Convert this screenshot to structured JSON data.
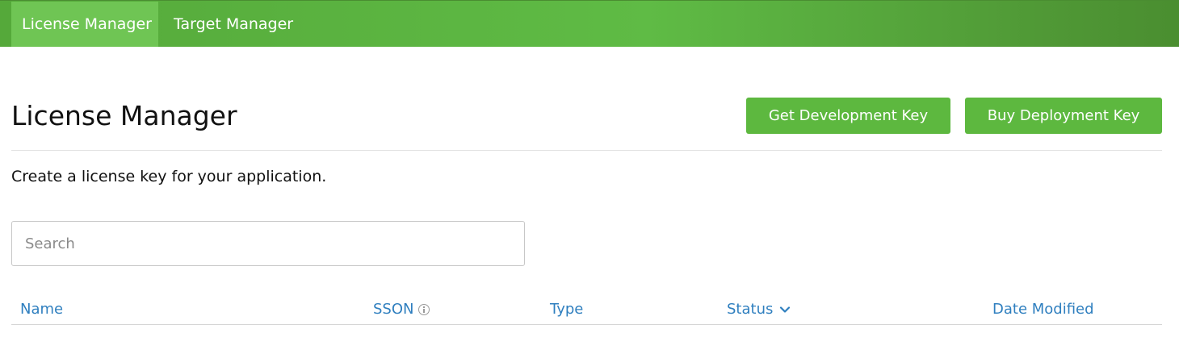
{
  "nav": {
    "tabs": [
      {
        "label": "License Manager",
        "active": true
      },
      {
        "label": "Target Manager",
        "active": false
      }
    ]
  },
  "page": {
    "title": "License Manager",
    "subtitle": "Create a license key for your application."
  },
  "actions": {
    "get_dev_key": "Get Development Key",
    "buy_deploy_key": "Buy Deployment Key"
  },
  "search": {
    "placeholder": "Search",
    "value": ""
  },
  "table": {
    "columns": [
      {
        "label": "Name"
      },
      {
        "label": "SSON",
        "icon": "info-icon"
      },
      {
        "label": "Type"
      },
      {
        "label": "Status",
        "icon": "chevron-down-icon",
        "sorted": "descending"
      },
      {
        "label": "Date Modified"
      }
    ],
    "rows": []
  },
  "colors": {
    "nav_bar": "#5cb541",
    "nav_tab_active": "#6fc554",
    "button": "#5db83f",
    "link_blue": "#2f7fbf"
  }
}
